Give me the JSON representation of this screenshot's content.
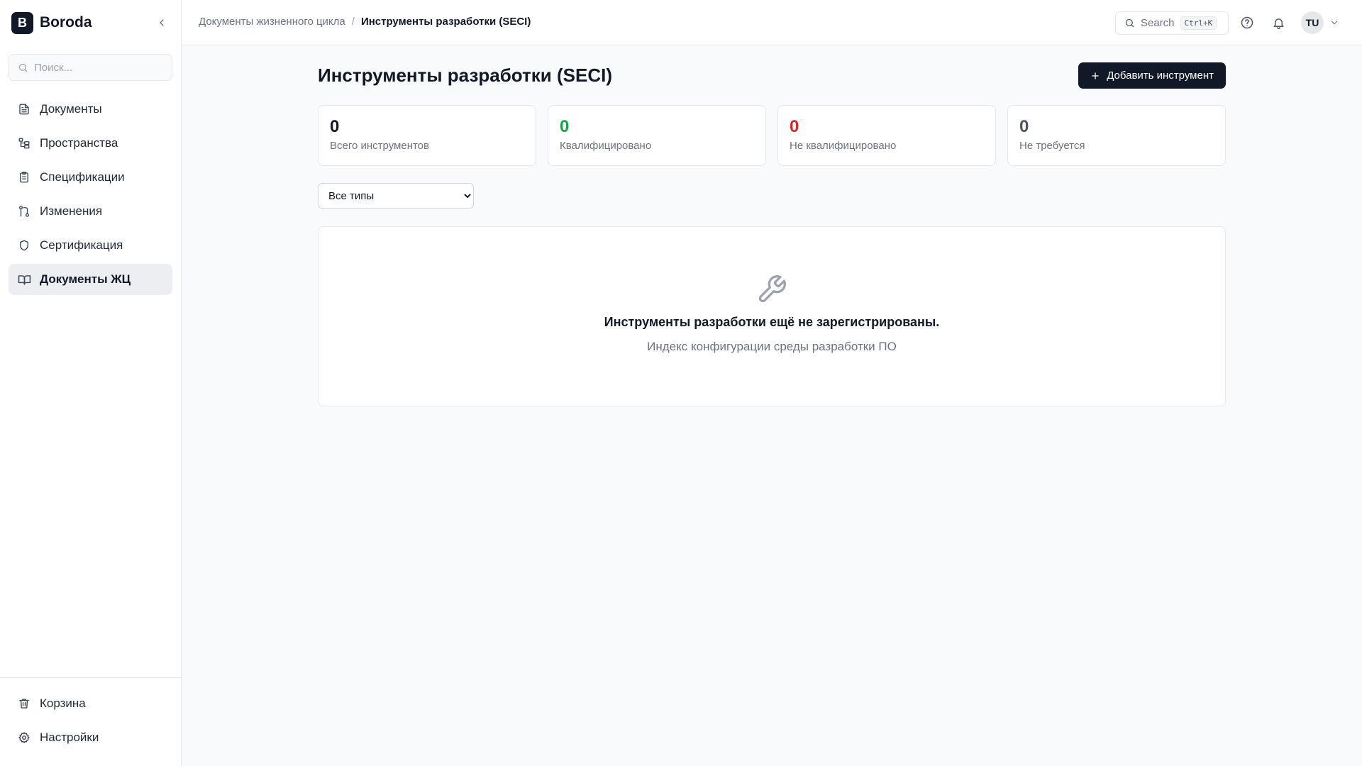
{
  "app": {
    "logo_letter": "B",
    "name": "Boroda"
  },
  "sidebar": {
    "search_placeholder": "Поиск...",
    "items": [
      {
        "label": "Документы",
        "icon": "file-text-icon"
      },
      {
        "label": "Пространства",
        "icon": "folder-tree-icon"
      },
      {
        "label": "Спецификации",
        "icon": "clipboard-icon"
      },
      {
        "label": "Изменения",
        "icon": "git-pull-request-icon"
      },
      {
        "label": "Сертификация",
        "icon": "shield-icon"
      },
      {
        "label": "Документы ЖЦ",
        "icon": "book-open-icon",
        "active": true
      }
    ],
    "bottom_items": [
      {
        "label": "Корзина",
        "icon": "trash-icon"
      },
      {
        "label": "Настройки",
        "icon": "gear-icon"
      }
    ]
  },
  "header": {
    "breadcrumb": [
      "Документы жизненного цикла",
      "Инструменты разработки (SECI)"
    ],
    "search_label": "Search",
    "search_shortcut": "Ctrl+K",
    "user_initials": "TU"
  },
  "main": {
    "title": "Инструменты разработки (SECI)",
    "add_button_label": "Добавить инструмент",
    "stats": [
      {
        "value": "0",
        "label": "Всего инструментов",
        "color": "#111827"
      },
      {
        "value": "0",
        "label": "Квалифицировано",
        "color": "#16a34a"
      },
      {
        "value": "0",
        "label": "Не квалифицировано",
        "color": "#dc2626"
      },
      {
        "value": "0",
        "label": "Не требуется",
        "color": "#4b5563"
      }
    ],
    "filter": {
      "selected": "Все типы"
    },
    "empty_state": {
      "icon": "wrench-icon",
      "title": "Инструменты разработки ещё не зарегистрированы.",
      "subtitle": "Индекс конфигурации среды разработки ПО"
    }
  }
}
